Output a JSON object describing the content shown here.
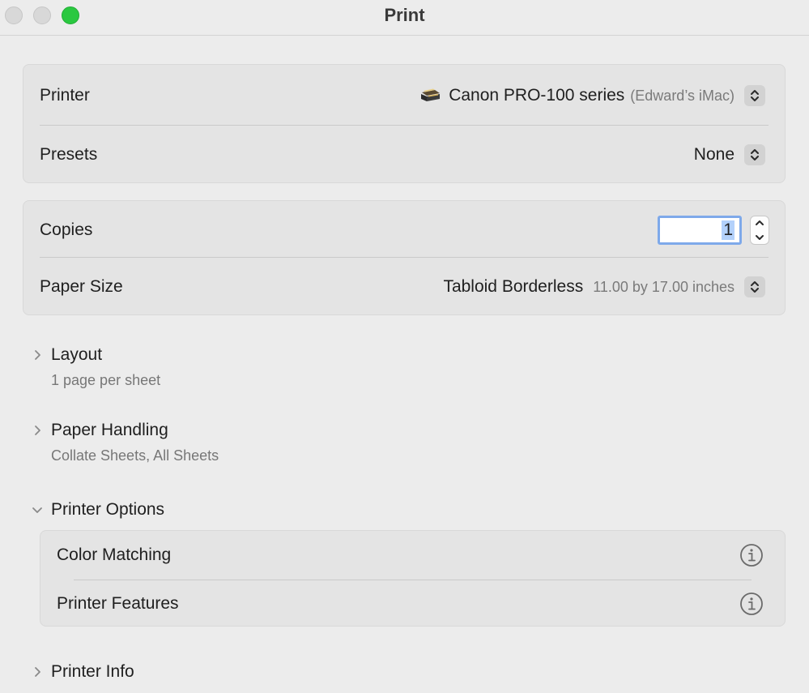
{
  "window": {
    "title": "Print"
  },
  "printer": {
    "label": "Printer",
    "name": "Canon PRO-100 series",
    "host": "(Edward’s iMac)"
  },
  "presets": {
    "label": "Presets",
    "value": "None"
  },
  "copies": {
    "label": "Copies",
    "value": "1"
  },
  "paper_size": {
    "label": "Paper Size",
    "value": "Tabloid Borderless",
    "dimensions": "11.00 by 17.00 inches"
  },
  "sections": {
    "layout": {
      "title": "Layout",
      "summary": "1 page per sheet",
      "expanded": false
    },
    "paper_handling": {
      "title": "Paper Handling",
      "summary": "Collate Sheets, All Sheets",
      "expanded": false
    },
    "printer_options": {
      "title": "Printer Options",
      "expanded": true,
      "items": [
        {
          "label": "Color Matching"
        },
        {
          "label": "Printer Features"
        }
      ]
    },
    "printer_info": {
      "title": "Printer Info",
      "expanded": false
    }
  },
  "colors": {
    "zoom_button": "#2ac840",
    "focus_ring": "#7ea9ea",
    "selection": "#b3d1fb"
  }
}
